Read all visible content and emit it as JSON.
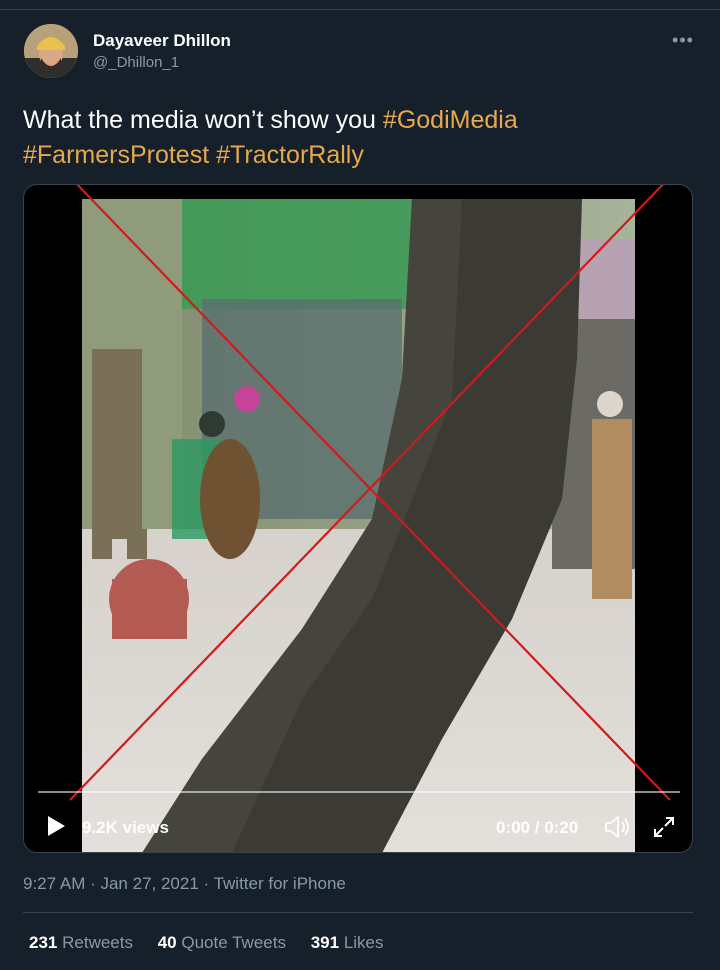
{
  "user": {
    "display_name": "Dayaveer Dhillon",
    "handle": "@_Dhillon_1"
  },
  "tweet": {
    "text": "What the media won’t show you",
    "hashtags": [
      "#GodiMedia",
      "#FarmersProtest",
      "#TractorRally"
    ]
  },
  "video": {
    "views": "9.2K views",
    "time": "0:00 / 0:20",
    "progress": 0
  },
  "meta": {
    "timestamp": "9:27 AM · Jan 27, 2021 · Twitter for iPhone"
  },
  "stats": {
    "retweets_count": "231",
    "retweets_label": "Retweets",
    "quotes_count": "40",
    "quotes_label": "Quote Tweets",
    "likes_count": "391",
    "likes_label": "Likes"
  },
  "colors": {
    "background": "#15202b",
    "hashtag": "#e7a84a",
    "secondary_text": "#8899a6",
    "cross": "#d11a1a"
  },
  "icons": [
    "more-icon",
    "play-icon",
    "volume-icon",
    "fullscreen-icon"
  ]
}
